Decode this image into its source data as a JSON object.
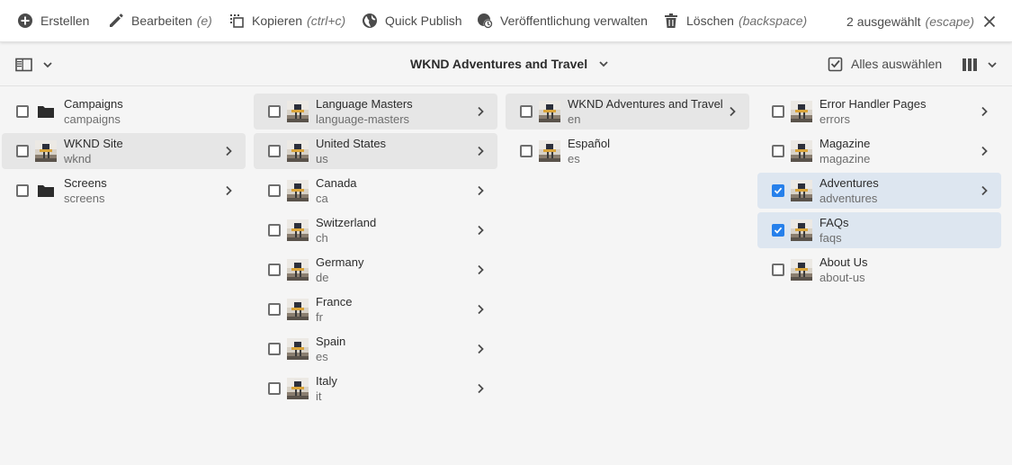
{
  "toolbar": {
    "create": "Erstellen",
    "edit": "Bearbeiten",
    "edit_shortcut": "(e)",
    "copy": "Kopieren",
    "copy_shortcut": "(ctrl+c)",
    "quick_publish": "Quick Publish",
    "manage_publication": "Veröffentlichung verwalten",
    "delete": "Löschen",
    "delete_shortcut": "(backspace)",
    "selected": "2 ausgewählt",
    "selected_shortcut": "(escape)"
  },
  "subbar": {
    "title": "WKND Adventures and Travel",
    "select_all": "Alles auswählen"
  },
  "columns": [
    {
      "items": [
        {
          "title": "Campaigns",
          "name": "campaigns",
          "icon": "folder-icon"
        },
        {
          "title": "WKND Site",
          "name": "wknd",
          "icon": "page-thumbnail"
        },
        {
          "title": "Screens",
          "name": "screens",
          "icon": "folder-icon"
        }
      ]
    },
    {
      "items": [
        {
          "title": "Language Masters",
          "name": "language-masters",
          "icon": "page-thumbnail"
        },
        {
          "title": "United States",
          "name": "us",
          "icon": "page-thumbnail"
        },
        {
          "title": "Canada",
          "name": "ca",
          "icon": "page-thumbnail"
        },
        {
          "title": "Switzerland",
          "name": "ch",
          "icon": "page-thumbnail"
        },
        {
          "title": "Germany",
          "name": "de",
          "icon": "page-thumbnail"
        },
        {
          "title": "France",
          "name": "fr",
          "icon": "page-thumbnail"
        },
        {
          "title": "Spain",
          "name": "es",
          "icon": "page-thumbnail"
        },
        {
          "title": "Italy",
          "name": "it",
          "icon": "page-thumbnail"
        }
      ]
    },
    {
      "items": [
        {
          "title": "WKND Adventures and Travel",
          "name": "en",
          "icon": "page-thumbnail"
        },
        {
          "title": "Español",
          "name": "es",
          "icon": "page-thumbnail"
        }
      ]
    },
    {
      "items": [
        {
          "title": "Error Handler Pages",
          "name": "errors",
          "icon": "page-thumbnail",
          "checked": false
        },
        {
          "title": "Magazine",
          "name": "magazine",
          "icon": "page-thumbnail",
          "checked": false
        },
        {
          "title": "Adventures",
          "name": "adventures",
          "icon": "page-thumbnail",
          "checked": true
        },
        {
          "title": "FAQs",
          "name": "faqs",
          "icon": "page-thumbnail",
          "checked": true
        },
        {
          "title": "About Us",
          "name": "about-us",
          "icon": "page-thumbnail",
          "checked": false
        }
      ]
    }
  ],
  "colors": {
    "accent": "#2680eb",
    "selected_row": "#dde6f0",
    "active_path_row": "#e6e6e6"
  }
}
